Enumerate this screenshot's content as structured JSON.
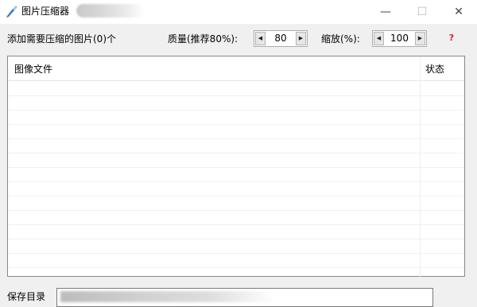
{
  "window": {
    "title": "图片压缩器",
    "controls": {
      "minimize": "—",
      "maximize": "☐",
      "close": "✕"
    }
  },
  "toolbar": {
    "add_label": "添加需要压缩的图片(0)个",
    "quality": {
      "label": "质量(推荐80%):",
      "value": "80"
    },
    "scale": {
      "label": "缩放(%):",
      "value": "100"
    },
    "help": "?"
  },
  "list": {
    "columns": [
      "图像文件",
      "状态"
    ],
    "rows": []
  },
  "footer": {
    "save_dir_label": "保存目录",
    "save_dir_value": ""
  },
  "icons": {
    "app": "compress-app-icon",
    "spin_left": "arrow-left-icon",
    "spin_right": "arrow-right-icon",
    "help": "help-icon"
  },
  "colors": {
    "background": "#f0f0f0",
    "help": "#e02020",
    "list_border": "#828790"
  }
}
